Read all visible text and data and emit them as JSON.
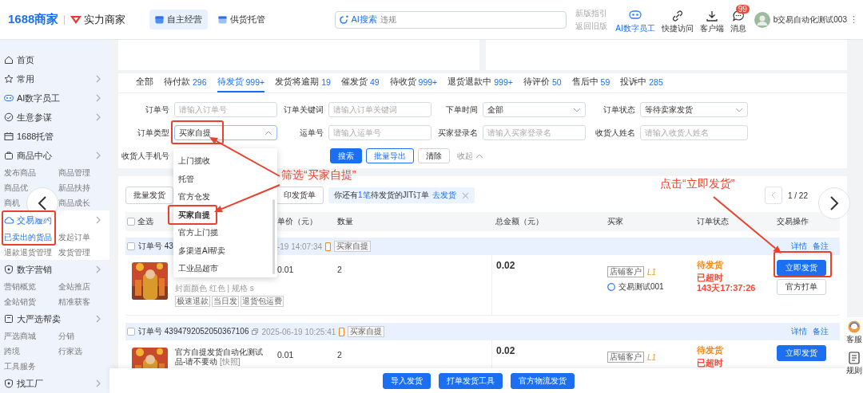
{
  "header": {
    "logo": "1688商家",
    "brand": "实力商家",
    "tabs": [
      {
        "label": "自主经营",
        "selected": true
      },
      {
        "label": "供货托管",
        "selected": false
      }
    ],
    "search": {
      "button": "AI搜索",
      "placeholder": "违规"
    },
    "guide": {
      "line1": "新版指引",
      "line2": "返回旧版"
    },
    "tools": [
      {
        "kind": "ai",
        "label": "AI数字员工",
        "selected": true
      },
      {
        "kind": "link",
        "label": "快捷访问",
        "selected": false
      },
      {
        "kind": "download",
        "label": "客户端",
        "selected": false
      },
      {
        "kind": "message",
        "label": "消息",
        "selected": false,
        "badge": "99"
      }
    ],
    "user": {
      "name": "b交易自动化测试003",
      "menu": "⋮"
    }
  },
  "sidebar": {
    "items": [
      {
        "kind": "home",
        "label": "首页",
        "has_arrow": false,
        "selected": false
      },
      {
        "kind": "star",
        "label": "常用",
        "has_arrow": true,
        "selected": false
      },
      {
        "kind": "robot",
        "label": "AI数字员工",
        "has_arrow": true,
        "selected": false
      },
      {
        "kind": "compass",
        "label": "生意参谋",
        "has_arrow": true,
        "selected": false
      },
      {
        "kind": "box",
        "label": "1688托管",
        "has_arrow": false,
        "selected": false
      },
      {
        "kind": "bag",
        "label": "商品中心",
        "has_arrow": true,
        "selected": false,
        "links": [
          {
            "label": "发布商品",
            "selected": false
          },
          {
            "label": "商品管理",
            "selected": false
          },
          {
            "label": "商品优",
            "selected": false
          },
          {
            "label": "新品扶持",
            "selected": false
          },
          {
            "label": "商机",
            "selected": false
          },
          {
            "label": "商品成长",
            "selected": false
          }
        ]
      },
      {
        "kind": "cloud",
        "label": "交易履约",
        "has_arrow": true,
        "selected": true,
        "links": [
          {
            "label": "已卖出的货品",
            "selected": true
          },
          {
            "label": "发起订单",
            "selected": false
          },
          {
            "label": "退款退货管理",
            "selected": false
          },
          {
            "label": "发货管理",
            "selected": false
          }
        ]
      },
      {
        "kind": "shield",
        "label": "数字营销",
        "has_arrow": true,
        "selected": false,
        "links": [
          {
            "label": "营销概览",
            "selected": false
          },
          {
            "label": "全站推店",
            "selected": false
          },
          {
            "label": "全站销货",
            "selected": false
          },
          {
            "label": "精准获客",
            "selected": false
          }
        ]
      },
      {
        "kind": "square",
        "label": "大严选帮卖",
        "has_arrow": true,
        "selected": false,
        "links": [
          {
            "label": "严选商城",
            "selected": false
          },
          {
            "label": "分销",
            "selected": false
          },
          {
            "label": "跨境",
            "selected": false
          },
          {
            "label": "行家选",
            "selected": false
          },
          {
            "label": "工具服务",
            "selected": false
          }
        ]
      },
      {
        "kind": "shield",
        "label": "找工厂",
        "has_arrow": true,
        "selected": false
      }
    ]
  },
  "nav": {
    "previous": true,
    "next": true
  },
  "order_tabs": [
    {
      "label": "全部",
      "selected": false
    },
    {
      "label": "待付款",
      "count": "296",
      "selected": false
    },
    {
      "label": "待发货",
      "count": "999+",
      "selected": true
    },
    {
      "label": "发货将逾期",
      "count": "19",
      "selected": false
    },
    {
      "label": "催发货",
      "count": "49",
      "selected": false
    },
    {
      "label": "待收货",
      "count": "999+",
      "selected": false
    },
    {
      "label": "退货退款中",
      "count": "999+",
      "selected": false
    },
    {
      "label": "待评价",
      "count": "50",
      "selected": false
    },
    {
      "label": "售后中",
      "count": "59",
      "selected": false
    },
    {
      "label": "投诉中",
      "count": "285",
      "selected": false
    }
  ],
  "filters": {
    "fields": [
      {
        "kind": "text",
        "label": "订单号",
        "placeholder": "请输入订单号"
      },
      {
        "kind": "text",
        "label": "订单关键词",
        "placeholder": "请输入订单关键词"
      },
      {
        "kind": "select",
        "label": "下单时间",
        "value": "全部",
        "open": false
      },
      {
        "kind": "select",
        "label": "订单状态",
        "value": "等待卖家发货",
        "open": false
      },
      {
        "kind": "select",
        "label": "订单类型",
        "value": "买家自提",
        "open": true
      },
      {
        "kind": "text",
        "label": "运单号",
        "placeholder": "请输入运单号"
      },
      {
        "kind": "text",
        "label": "买家登录名",
        "placeholder": "请输入买家登录名"
      },
      {
        "kind": "text",
        "label": "收货人姓名",
        "placeholder": "请输入收货人姓名"
      },
      {
        "kind": "covered",
        "label": "收货人手机号"
      }
    ],
    "buttons": [
      {
        "kind": "primary",
        "label": "搜索"
      },
      {
        "kind": "outline",
        "label": "批量导出"
      },
      {
        "kind": "plain",
        "label": "清除"
      },
      {
        "kind": "link",
        "label": "收起"
      }
    ]
  },
  "dropdown": {
    "options": [
      {
        "label": "上门揽收",
        "selected": false
      },
      {
        "label": "托管",
        "selected": false
      },
      {
        "label": "官方仓发",
        "selected": false
      },
      {
        "label": "买家自提",
        "selected": true
      },
      {
        "label": "官方上门揽",
        "selected": false
      },
      {
        "label": "多渠道AI帮卖",
        "selected": false
      },
      {
        "label": "工业品超市",
        "selected": false
      }
    ]
  },
  "toolbar": {
    "buttons": [
      "批量发货",
      "印发货单"
    ],
    "notice": {
      "before": "你还有",
      "highlight": "1笔",
      "after": "待发货的JIT订单",
      "link": "去发货"
    },
    "pagination": "1 / 22"
  },
  "table": {
    "select_all_checked": false,
    "columns": [
      "全选",
      "单价（元）",
      "数量",
      "总金额（元）",
      "买家",
      "订单状态",
      "交易操作"
    ]
  },
  "orders": [
    {
      "checked": false,
      "partly_covered": true,
      "order_no": "订单号 43",
      "has_copy": false,
      "time": "-19 14:07:34",
      "type_tag": "买家自提",
      "actions": [
        "详情",
        "备注"
      ],
      "item": {
        "spec": "封面颜色 红色 | 规格 s",
        "tags": [
          "极速退款",
          "当日发",
          "退货包运费"
        ]
      },
      "price": "0.01",
      "quantity": "2",
      "total": "0.02",
      "buyer": {
        "tag": "店铺客户",
        "level": "L1",
        "name": "交易测试001"
      },
      "status": [
        {
          "text": "待发货",
          "color": "#f28b1f"
        },
        {
          "text": "已超时",
          "color": "#f04b3a"
        },
        {
          "text": "143天17:37:26",
          "color": "#f04b3a"
        }
      ],
      "buttons": [
        {
          "kind": "primary",
          "label": "立即发货"
        },
        {
          "kind": "outline",
          "label": "官方打单"
        }
      ]
    },
    {
      "checked": false,
      "partly_covered": false,
      "order_no": "订单号 4394792052050367106",
      "has_copy": true,
      "time": "2025-06-19 10:25:41",
      "type_tag": "买家自提",
      "actions": [
        "详情",
        "备注"
      ],
      "item": {
        "title": "官方自提发货自动化测试品-请不要动",
        "snapshot": "[快照]"
      },
      "price": "0.01",
      "quantity": "2",
      "total": "0.02",
      "buyer": {
        "tag": "店铺客户",
        "level": "L1"
      },
      "status": [
        {
          "text": "待发货",
          "color": "#f28b1f"
        },
        {
          "text": "已超时",
          "color": "#f04b3a"
        }
      ],
      "buttons": [
        {
          "kind": "primary",
          "label": "立即发货"
        }
      ]
    }
  ],
  "bottom_bar": {
    "buttons": [
      "导入发货",
      "打单发货工具",
      "官方物流发货"
    ]
  },
  "float": {
    "items": [
      {
        "kind": "service",
        "label": "客服"
      },
      {
        "kind": "rules",
        "label": "规则"
      }
    ]
  },
  "annotations": [
    {
      "kind": "filter-hint",
      "text": "筛选“买家自提”"
    },
    {
      "kind": "ship-hint",
      "text": "点击“立即发货”"
    }
  ]
}
